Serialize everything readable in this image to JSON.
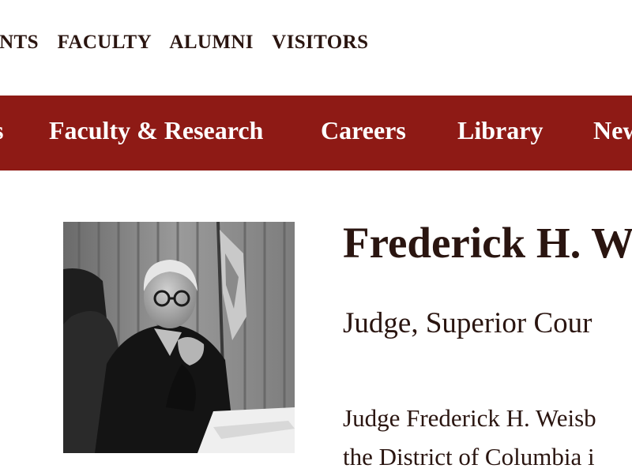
{
  "top_nav": {
    "items": [
      "ENTS",
      "FACULTY",
      "ALUMNI",
      "VISITORS"
    ]
  },
  "main_nav": {
    "items": [
      "s",
      "Faculty & Research",
      "Careers",
      "Library",
      "New"
    ]
  },
  "profile": {
    "name": "Frederick H. W",
    "title": "Judge, Superior Cour",
    "bio_lines": [
      "Judge Frederick H. Weisb",
      "the District of Columbia i"
    ],
    "photo_icon": "judge-portrait"
  },
  "colors": {
    "brand": "#8e1a15",
    "text": "#2a1510"
  }
}
